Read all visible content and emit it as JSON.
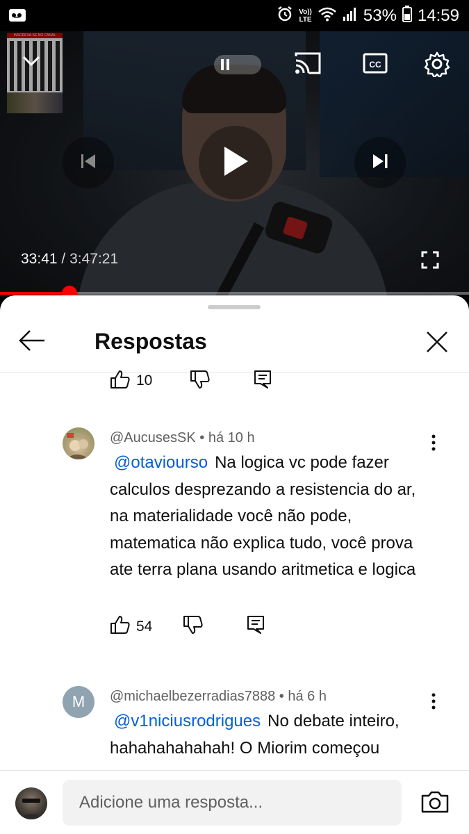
{
  "status_bar": {
    "volte_line1": "Vo))",
    "volte_line2": "LTE",
    "battery": "53%",
    "time": "14:59"
  },
  "video": {
    "current_time": "33:41",
    "separator": " / ",
    "duration": "3:47:21",
    "progress_fraction": 0.148,
    "overlay_text": "INSCREVA-SE NO CANAL",
    "icons": [
      "collapse-chevron-icon",
      "pause-icon",
      "cast-icon",
      "cc-icon",
      "settings-gear-icon",
      "previous-icon",
      "play-icon",
      "next-icon",
      "fullscreen-icon"
    ]
  },
  "sheet": {
    "title": "Respostas",
    "prev_comment_likes": "10"
  },
  "comments": [
    {
      "author": "@AucusesSK",
      "age": "há 10 h",
      "mention": "@otaviourso",
      "text": "Na logica vc pode fazer calculos desprezando a resistencia do ar, na materialidade você não pode, matematica não explica tudo, você prova ate terra plana usando aritmetica e logica",
      "likes": "54"
    },
    {
      "author": "@michaelbezerradias7888",
      "age": "há 6 h",
      "avatar_letter": "M",
      "avatar_color": "#8fa3b0",
      "mention": "@v1niciusrodrigues",
      "text": "No debate inteiro, hahahahahahah! O Miorim começou"
    }
  ],
  "reply_bar": {
    "placeholder": "Adicione uma resposta..."
  },
  "colors": {
    "accent_red": "#ff0000",
    "mention_blue": "#065fd4"
  }
}
